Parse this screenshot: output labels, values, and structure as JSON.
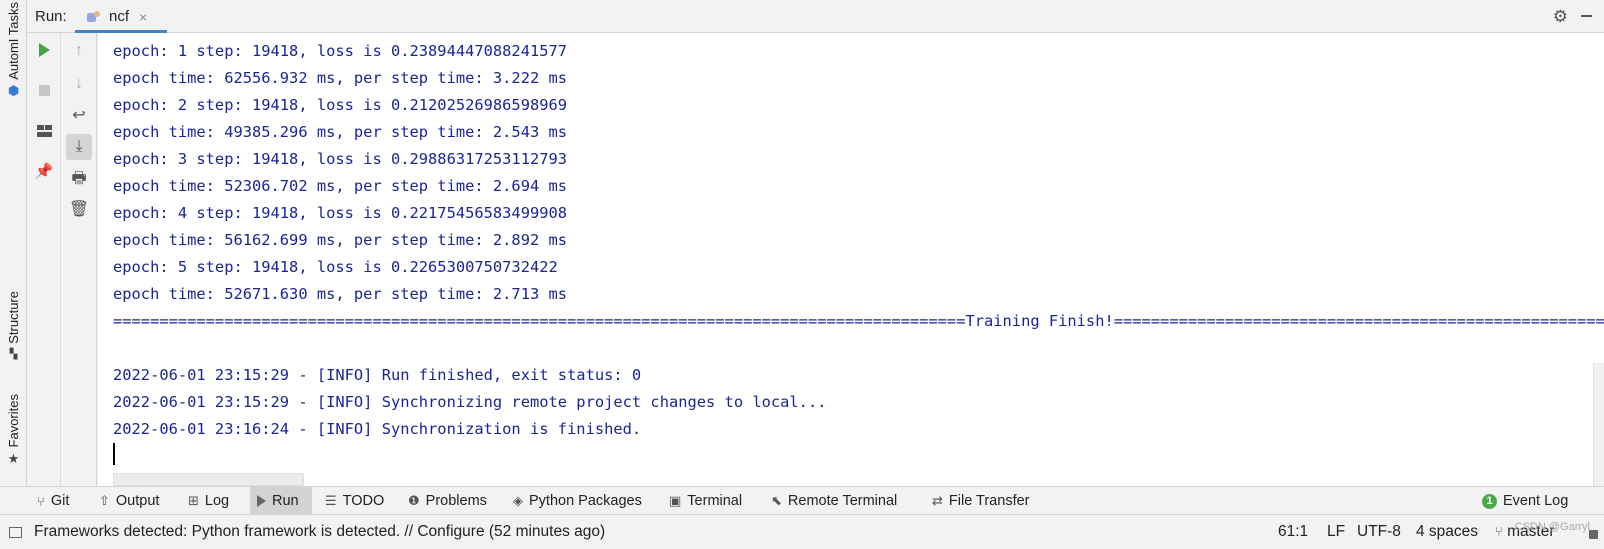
{
  "left_strip": {
    "automl_tasks_label": "AutomI Tasks",
    "structure_label": "Structure",
    "favorites_label": "Favorites",
    "icons": [
      "automl-icon",
      "structure-icon",
      "star-icon"
    ]
  },
  "run_header": {
    "label": "Run:",
    "tab_name": "ncf",
    "tab_close": "×"
  },
  "console": {
    "lines": [
      "epoch: 1 step: 19418, loss is 0.23894447088241577",
      "epoch time: 62556.932 ms, per step time: 3.222 ms",
      "epoch: 2 step: 19418, loss is 0.21202526986598969",
      "epoch time: 49385.296 ms, per step time: 2.543 ms",
      "epoch: 3 step: 19418, loss is 0.29886317253112793",
      "epoch time: 52306.702 ms, per step time: 2.694 ms",
      "epoch: 4 step: 19418, loss is 0.22175456583499908",
      "epoch time: 56162.699 ms, per step time: 2.892 ms",
      "epoch: 5 step: 19418, loss is 0.2265300750732422",
      "epoch time: 52671.630 ms, per step time: 2.713 ms",
      "============================================================================================Training Finish!==============================================================================================",
      "",
      "2022-06-01 23:15:29 - [INFO] Run finished, exit status: 0",
      "2022-06-01 23:15:29 - [INFO] Synchronizing remote project changes to local...",
      "2022-06-01 23:16:24 - [INFO] Synchronization is finished."
    ],
    "text_color": "#1c2497"
  },
  "bottom_tabs": {
    "git": "Git",
    "output": "Output",
    "log": "Log",
    "run": "Run",
    "todo": "TODO",
    "problems": "Problems",
    "python_packages": "Python Packages",
    "terminal": "Terminal",
    "remote_terminal": "Remote Terminal",
    "file_transfer": "File Transfer",
    "event_log": "Event Log",
    "event_log_count": "1"
  },
  "status_bar": {
    "message": "Frameworks detected: Python framework is detected. // Configure (52 minutes ago)",
    "position": "61:1",
    "line_ending": "LF",
    "encoding": "UTF-8",
    "indent": "4 spaces",
    "branch": "master",
    "watermark": "CSDN @Garryl"
  },
  "colors": {
    "accent": "#4083c9",
    "run_green": "#49a048",
    "console_text": "#1c2497"
  }
}
